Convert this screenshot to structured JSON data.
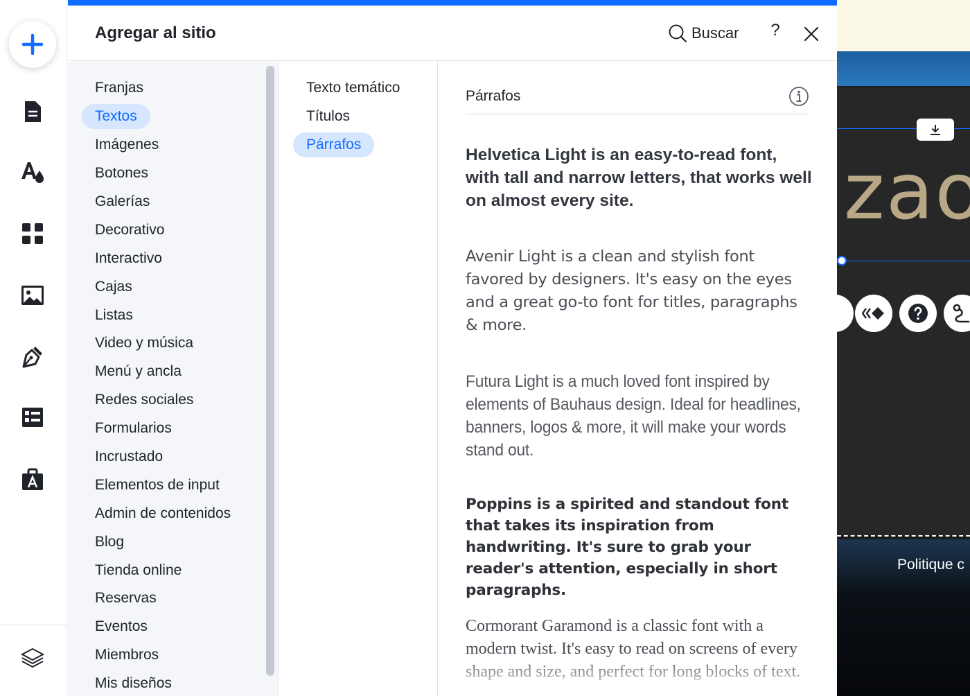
{
  "panel": {
    "title": "Agregar al sitio",
    "search_label": "Buscar",
    "help_label": "?"
  },
  "categories": [
    {
      "label": "Franjas"
    },
    {
      "label": "Textos",
      "active": true
    },
    {
      "label": "Imágenes"
    },
    {
      "label": "Botones"
    },
    {
      "label": "Galerías"
    },
    {
      "label": "Decorativo"
    },
    {
      "label": "Interactivo"
    },
    {
      "label": "Cajas"
    },
    {
      "label": "Listas"
    },
    {
      "label": "Video y música"
    },
    {
      "label": "Menú y ancla"
    },
    {
      "label": "Redes sociales"
    },
    {
      "label": "Formularios"
    },
    {
      "label": "Incrustado"
    },
    {
      "label": "Elementos de input"
    },
    {
      "label": "Admin de contenidos"
    },
    {
      "label": "Blog"
    },
    {
      "label": "Tienda online"
    },
    {
      "label": "Reservas"
    },
    {
      "label": "Eventos"
    },
    {
      "label": "Miembros"
    },
    {
      "label": "Mis diseños"
    }
  ],
  "subcategories": [
    {
      "label": "Texto temático"
    },
    {
      "label": "Títulos"
    },
    {
      "label": "Párrafos",
      "active": true
    }
  ],
  "content": {
    "section_title": "Párrafos",
    "samples": [
      "Helvetica Light is an easy-to-read font, with tall and narrow letters, that works well on almost every site.",
      "Avenir Light is a clean and stylish font favored by designers. It's easy on the eyes and a great go-to font for titles, paragraphs & more.",
      "Futura Light is a much loved font inspired by elements of Bauhaus design. Ideal for headlines, banners, logos & more, it will make your words stand out.",
      "Poppins is a spirited and standout font that takes its inspiration from handwriting. It's sure to grab your reader's attention, especially in short paragraphs.",
      "Cormorant Garamond is a classic font with a modern twist. It's easy to read on screens of every shape and size, and perfect for long blocks of text."
    ]
  },
  "canvas": {
    "big_text": "zao",
    "footer_text": "Politique c"
  },
  "colors": {
    "accent": "#116dff",
    "active_bg": "#d6e6fe",
    "text": "#20242a",
    "canvas_dark": "#272727",
    "canvas_gold": "#b8a886"
  },
  "icons": {
    "rail": [
      "add-icon",
      "pages-icon",
      "design-icon",
      "apps-icon",
      "media-icon",
      "pen-icon",
      "table-icon",
      "business-icon",
      "layers-icon"
    ]
  }
}
